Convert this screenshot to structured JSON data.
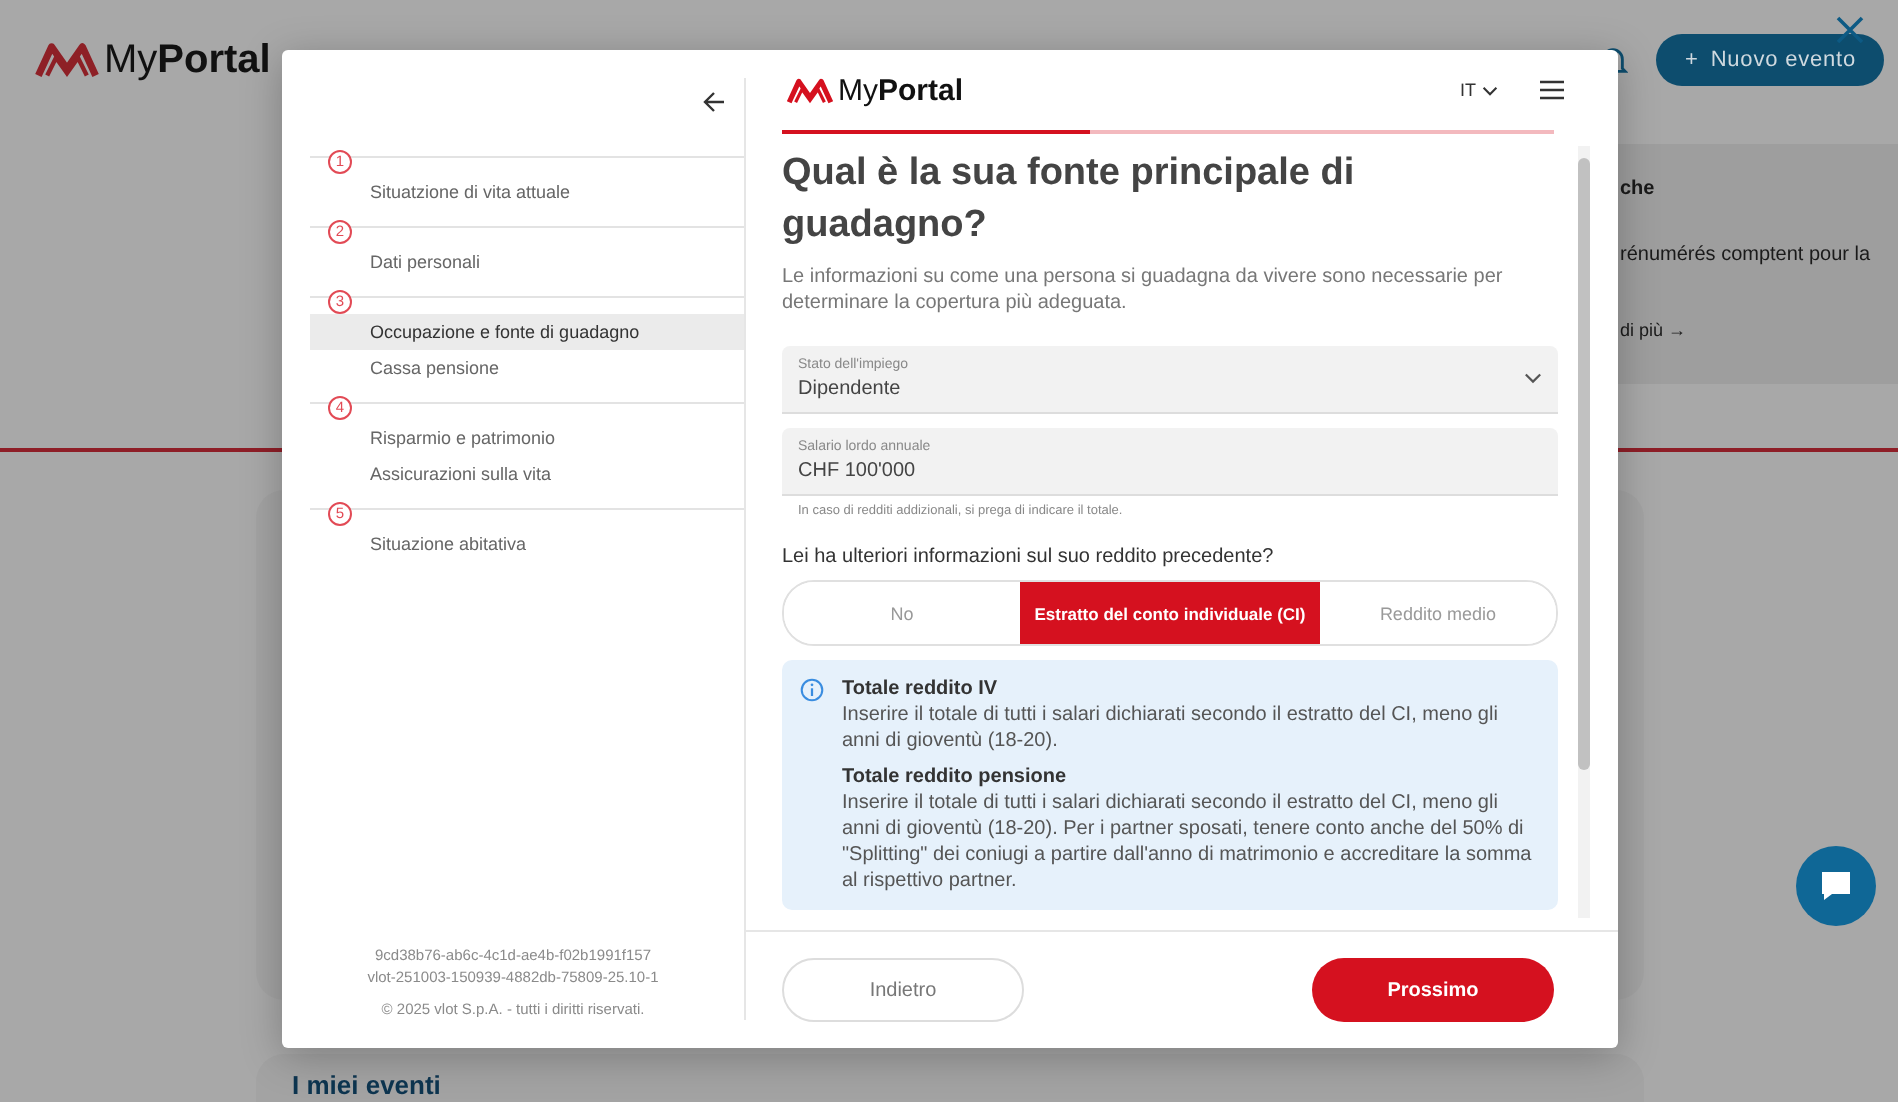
{
  "page": {
    "logo": {
      "prefix": "My",
      "bold": "Portal"
    },
    "new_event_button": {
      "icon": "+",
      "label": "Nuovo evento"
    },
    "promo_card": {
      "title": "che",
      "text": "rénumérés comptent pour la",
      "link": "di più →"
    },
    "section_title": "I miei eventi"
  },
  "modal": {
    "steps": [
      {
        "number": "1",
        "items": [
          {
            "label": "Situatzione di vita attuale",
            "selected": false
          }
        ]
      },
      {
        "number": "2",
        "items": [
          {
            "label": "Dati personali",
            "selected": false
          }
        ]
      },
      {
        "number": "3",
        "items": [
          {
            "label": "Occupazione e fonte di guadagno",
            "selected": true
          },
          {
            "label": "Cassa pensione",
            "selected": false
          }
        ]
      },
      {
        "number": "4",
        "items": [
          {
            "label": "Risparmio e patrimonio",
            "selected": false
          },
          {
            "label": "Assicurazioni sulla vita",
            "selected": false
          }
        ]
      },
      {
        "number": "5",
        "items": [
          {
            "label": "Situazione abitativa",
            "selected": false
          }
        ]
      }
    ],
    "footer_lines": [
      "9cd38b76-ab6c-4c1d-ae4b-f02b1991f157",
      "vlot-251003-150939-4882db-75809-25.10-1",
      "© 2025 vlot S.p.A. - tutti i diritti riservati."
    ],
    "header": {
      "logo": {
        "prefix": "My",
        "bold": "Portal"
      },
      "language": "IT"
    },
    "progress": {
      "level": 0.4
    },
    "title": "Qual è la sua fonte principale di guadagno?",
    "description": "Le informazioni su come una persona si guadagna da vivere sono necessarie per determinare la copertura più adeguata.",
    "fields": [
      {
        "kind": "select",
        "label": "Stato dell'impiego",
        "value": "Dipendente"
      },
      {
        "kind": "input",
        "label": "Salario lordo annuale",
        "value": "CHF 100'000",
        "hint": "In caso di redditi addizionali, si prega di indicare il totale."
      }
    ],
    "question": "Lei ha ulteriori informazioni sul suo reddito precedente?",
    "options": [
      {
        "label": "No",
        "selected": false
      },
      {
        "label": "Estratto del conto individuale (CI)",
        "selected": true
      },
      {
        "label": "Reddito medio",
        "selected": false
      }
    ],
    "info": [
      {
        "title": "Totale reddito IV",
        "text": "Inserire il totale di tutti i salari dichiarati secondo il estratto del CI, meno gli anni di gioventù (18-20)."
      },
      {
        "title": "Totale reddito pensione",
        "text": "Inserire il totale di tutti i salari dichiarati secondo il estratto del CI, meno gli anni di gioventù (18-20). Per i partner sposati, tenere conto anche del 50% di \"Splitting\" dei coniugi a partire dall'anno di matrimonio e accreditare la somma al rispettivo partner."
      }
    ],
    "buttons": {
      "back": "Indietro",
      "next": "Prossimo"
    }
  }
}
